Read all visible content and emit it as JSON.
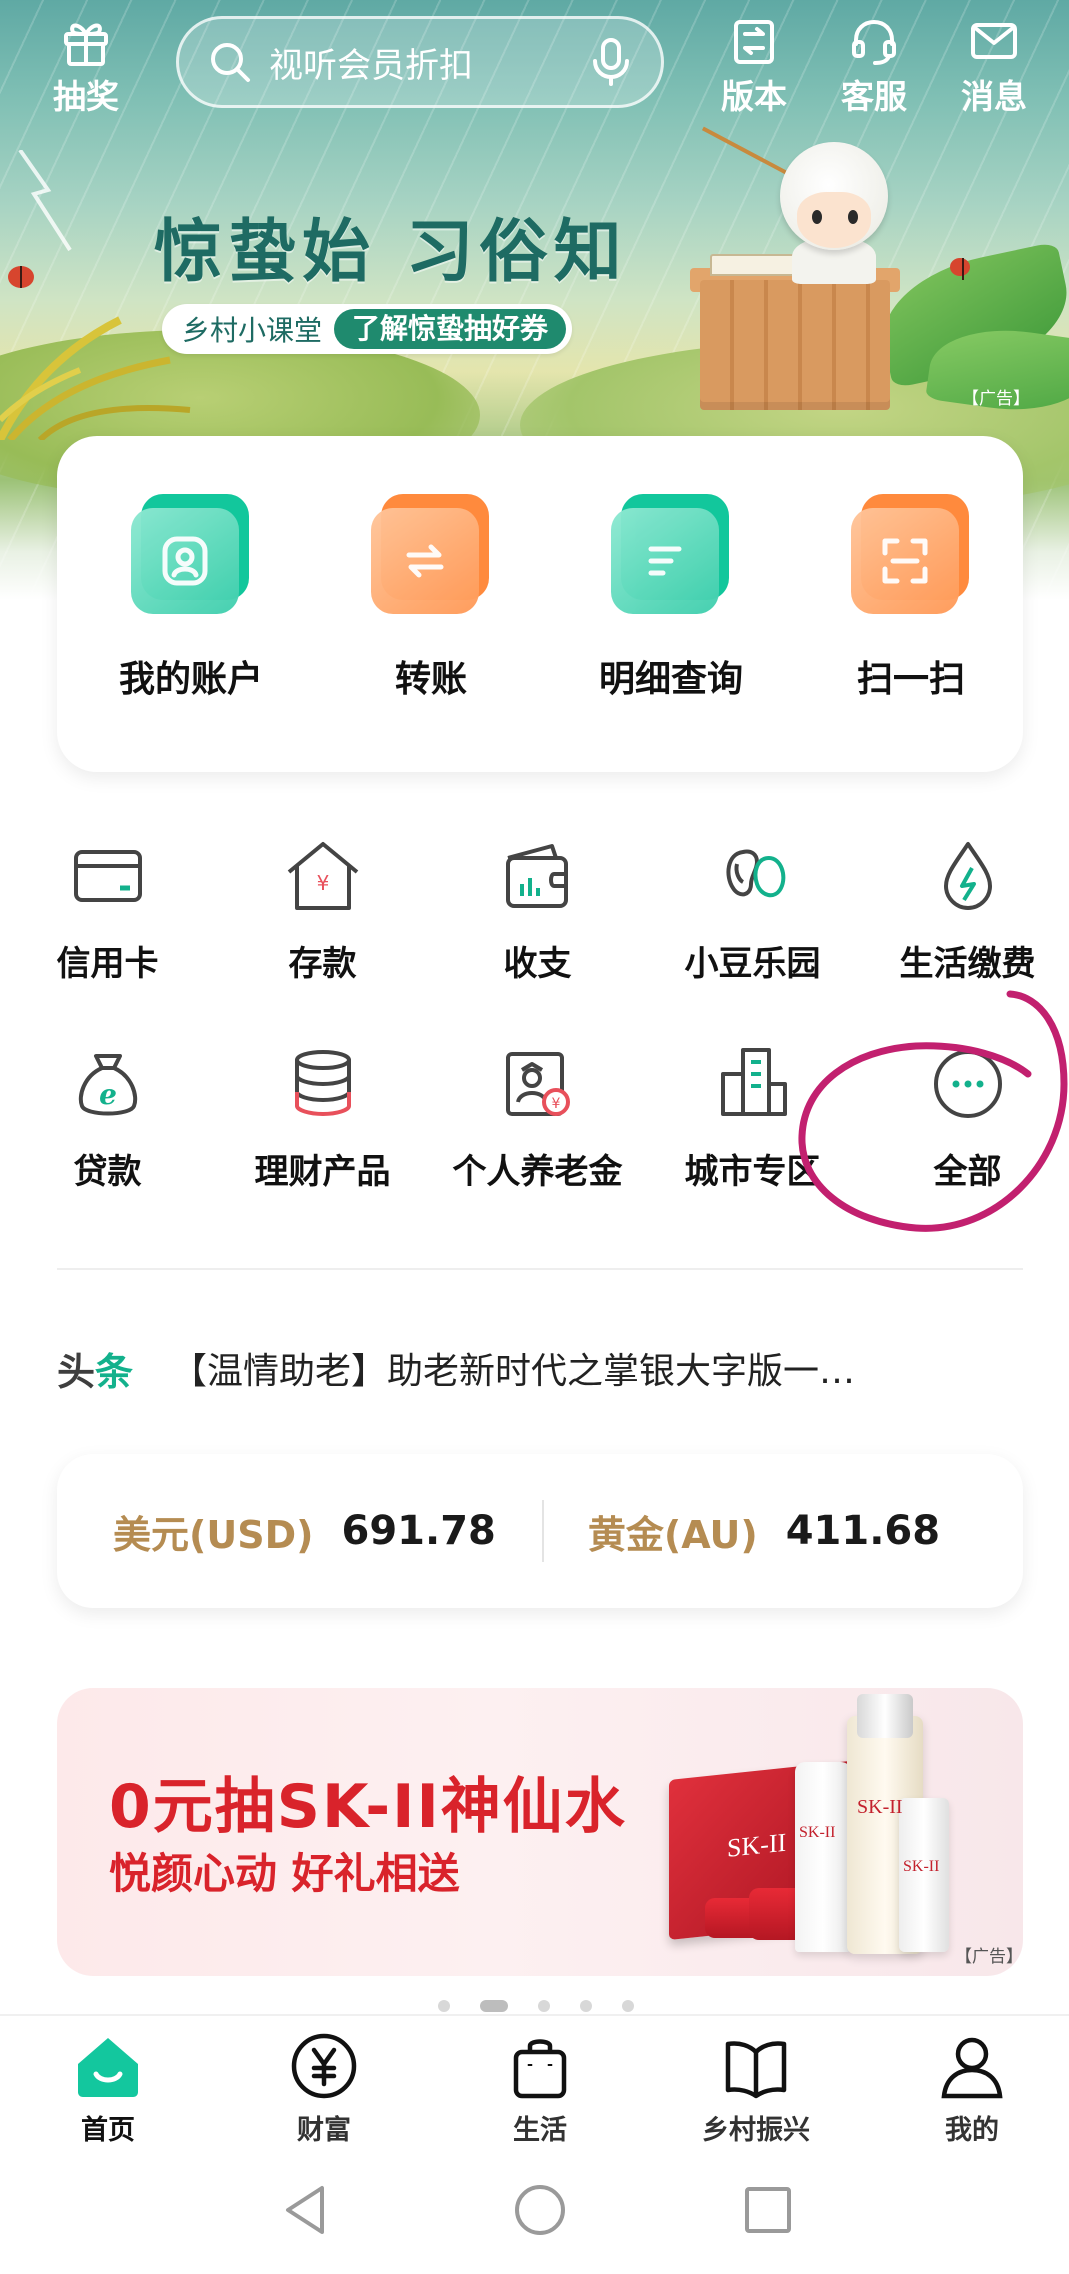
{
  "topbar": {
    "lottery_label": "抽奖",
    "search_placeholder": "视听会员折扣",
    "version_label": "版本",
    "service_label": "客服",
    "messages_label": "消息"
  },
  "hero": {
    "title": "惊蛰始 习俗知",
    "pill_left": "乡村小课堂",
    "pill_right": "了解惊蛰抽好券",
    "ad_tag": "【广告】"
  },
  "quick_actions": [
    {
      "label": "我的账户",
      "icon": "user-icon",
      "color": "teal"
    },
    {
      "label": "转账",
      "icon": "transfer-icon",
      "color": "orange"
    },
    {
      "label": "明细查询",
      "icon": "list-icon",
      "color": "teal"
    },
    {
      "label": "扫一扫",
      "icon": "scan-icon",
      "color": "orange"
    }
  ],
  "services": [
    {
      "label": "信用卡",
      "icon": "credit-card-icon"
    },
    {
      "label": "存款",
      "icon": "deposit-house-icon"
    },
    {
      "label": "收支",
      "icon": "wallet-icon"
    },
    {
      "label": "小豆乐园",
      "icon": "bean-icon"
    },
    {
      "label": "生活缴费",
      "icon": "water-drop-icon"
    },
    {
      "label": "贷款",
      "icon": "money-bag-icon"
    },
    {
      "label": "理财产品",
      "icon": "coin-stack-icon"
    },
    {
      "label": "个人养老金",
      "icon": "pension-icon"
    },
    {
      "label": "城市专区",
      "icon": "city-buildings-icon"
    },
    {
      "label": "全部",
      "icon": "more-icon"
    }
  ],
  "headline": {
    "tag_a": "头",
    "tag_b": "条",
    "text": "【温情助老】助老新时代之掌银大字版一…"
  },
  "rates": [
    {
      "name": "美元(USD)",
      "value": "691.78"
    },
    {
      "name": "黄金(AU)",
      "value": "411.68"
    }
  ],
  "promo": {
    "title": "0元抽SK-II神仙水",
    "subtitle": "悦颜心动 好礼相送",
    "ad_tag": "【广告】",
    "brand": "SK-II",
    "active_slide": 2,
    "slide_count": 5
  },
  "tabs": [
    {
      "label": "首页",
      "icon": "home-icon",
      "active": true
    },
    {
      "label": "财富",
      "icon": "yuan-icon",
      "active": false
    },
    {
      "label": "生活",
      "icon": "shopping-bag-icon",
      "active": false
    },
    {
      "label": "乡村振兴",
      "icon": "book-icon",
      "active": false
    },
    {
      "label": "我的",
      "icon": "person-icon",
      "active": false
    }
  ],
  "colors": {
    "brand_green": "#13b18c",
    "gold": "#b58c52",
    "promo_red": "#d9232b",
    "annotation_magenta": "#c2206f"
  }
}
